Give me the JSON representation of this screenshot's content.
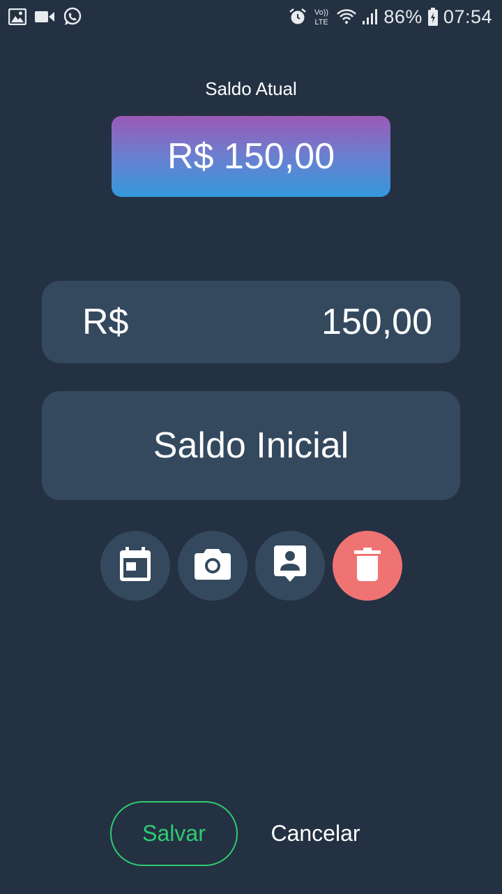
{
  "status_bar": {
    "left_icons": [
      "gallery-icon",
      "video-camera-icon",
      "whatsapp-icon"
    ],
    "right_icons": [
      "alarm-icon",
      "volte-icon",
      "wifi-icon",
      "signal-icon",
      "battery-icon"
    ],
    "volte_top": "Vo))",
    "volte_bottom": "LTE",
    "battery": "86%",
    "time": "07:54"
  },
  "balance": {
    "label": "Saldo Atual",
    "value": "R$ 150,00"
  },
  "form": {
    "amount": {
      "currency": "R$",
      "value": "150,00"
    },
    "description": {
      "value": "Saldo Inicial"
    }
  },
  "actions": {
    "icons": [
      "calendar-icon",
      "camera-icon",
      "contact-icon",
      "trash-icon"
    ]
  },
  "buttons": {
    "save_label": "Salvar",
    "cancel_label": "Cancelar"
  },
  "colors": {
    "background": "#233142",
    "field_bg": "#34495e",
    "gradient_top": "#9b59b6",
    "gradient_bottom": "#3498db",
    "save_green": "#2ecc71",
    "delete_red": "#f07373"
  }
}
